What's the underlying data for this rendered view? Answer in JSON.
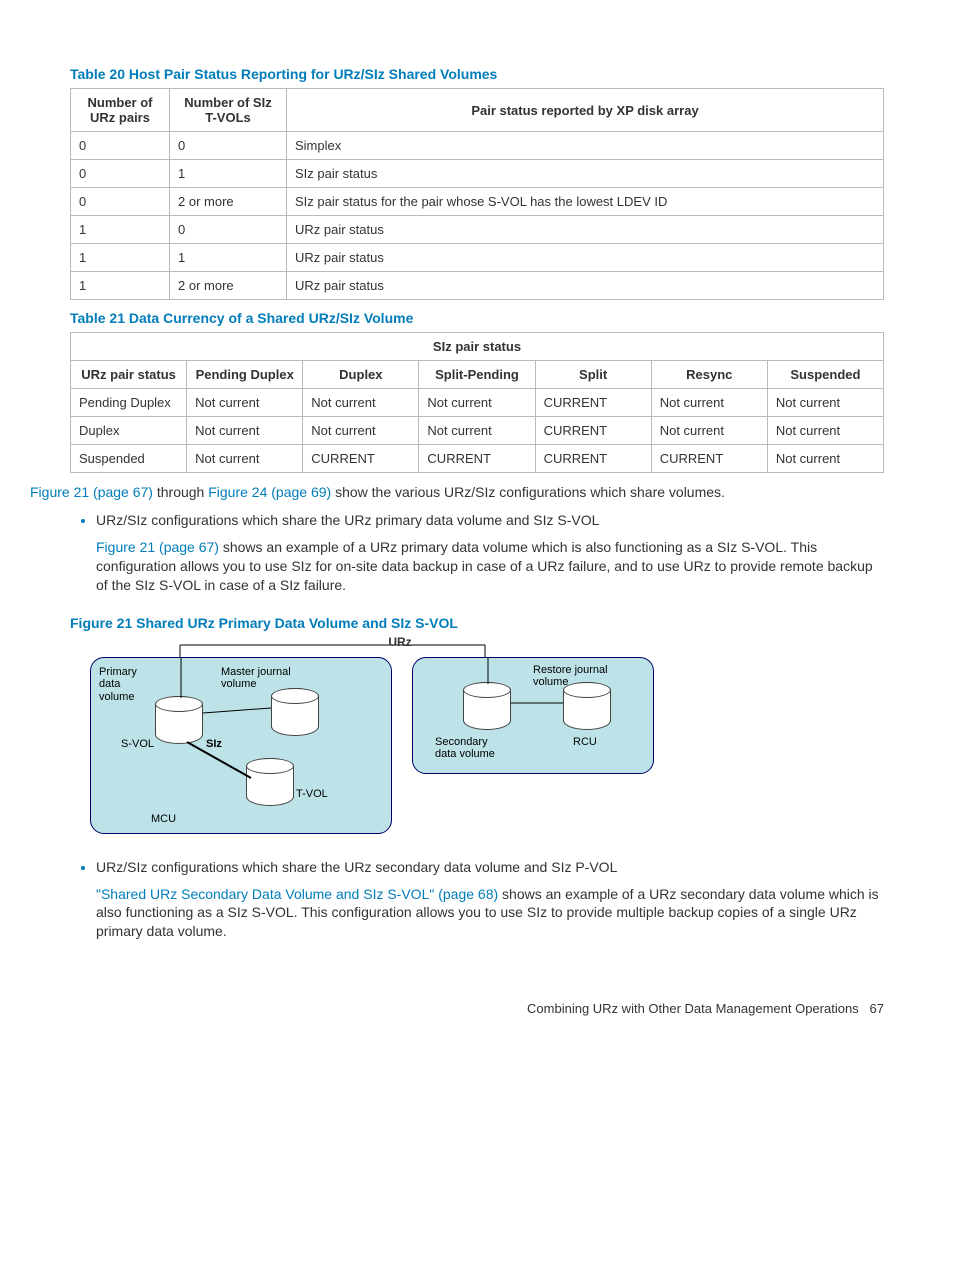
{
  "tables": {
    "t20": {
      "title": "Table 20 Host Pair Status Reporting for URz/SIz Shared Volumes",
      "headers": [
        "Number of URz pairs",
        "Number of SIz T-VOLs",
        "Pair status reported by XP disk array"
      ],
      "rows": [
        [
          "0",
          "0",
          "Simplex"
        ],
        [
          "0",
          "1",
          "SIz pair status"
        ],
        [
          "0",
          "2 or more",
          "SIz pair status for the pair whose S-VOL has the lowest LDEV ID"
        ],
        [
          "1",
          "0",
          "URz pair status"
        ],
        [
          "1",
          "1",
          "URz pair status"
        ],
        [
          "1",
          "2 or more",
          "URz pair status"
        ]
      ]
    },
    "t21": {
      "title": "Table 21 Data Currency of a Shared URz/SIz Volume",
      "span_header": "SIz pair status",
      "col_headers": [
        "URz pair status",
        "Pending Duplex",
        "Duplex",
        "Split-Pending",
        "Split",
        "Resync",
        "Suspended"
      ],
      "rows": [
        [
          "Pending Duplex",
          "Not current",
          "Not current",
          "Not current",
          "CURRENT",
          "Not current",
          "Not current"
        ],
        [
          "Duplex",
          "Not current",
          "Not current",
          "Not current",
          "CURRENT",
          "Not current",
          "Not current"
        ],
        [
          "Suspended",
          "Not current",
          "CURRENT",
          "CURRENT",
          "CURRENT",
          "CURRENT",
          "Not current"
        ]
      ]
    }
  },
  "para1": {
    "link1": "Figure 21 (page 67)",
    "mid": " through ",
    "link2": "Figure 24 (page 69)",
    "tail": " show the various URz/SIz configurations which share volumes."
  },
  "bullet1": {
    "line1": "URz/SIz configurations which share the URz primary data volume and SIz S-VOL",
    "link": "Figure 21 (page 67)",
    "text": " shows an example of a URz primary data volume which is also functioning as a SIz S-VOL. This configuration allows you to use SIz for on-site data backup in case of a URz failure, and to use URz to provide remote backup of the SIz S-VOL in case of a SIz failure."
  },
  "figure21": {
    "title": "Figure 21 Shared URz Primary Data Volume and SIz S-VOL",
    "urz": "URz",
    "left": {
      "primary": "Primary\ndata\nvolume",
      "master": "Master journal\nvolume",
      "svol": "S-VOL",
      "siz": "SIz",
      "tvol": "T-VOL",
      "mcu": "MCU"
    },
    "right": {
      "restore": "Restore journal\nvolume",
      "secondary": "Secondary\ndata volume",
      "rcu": "RCU"
    }
  },
  "bullet2": {
    "line1": "URz/SIz configurations which share the URz secondary data volume and SIz P-VOL",
    "link": "\"Shared URz Secondary Data Volume and SIz S-VOL\" (page 68)",
    "text": " shows an example of a URz secondary data volume which is also functioning as a SIz S-VOL. This configuration allows you to use SIz to provide multiple backup copies of a single URz primary data volume."
  },
  "footer": {
    "section": "Combining URz with Other Data Management Operations",
    "page": "67"
  }
}
